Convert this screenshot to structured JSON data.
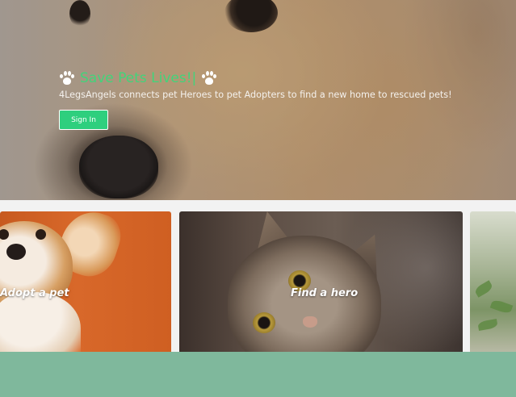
{
  "hero": {
    "title": "Save Pets Lives!|",
    "subtitle": "4LegsAngels connects pet Heroes to pet Adopters to find a new home to rescued pets!",
    "signin_label": "Sign In",
    "icons": [
      "paw-icon",
      "paw-icon"
    ]
  },
  "cards": [
    {
      "label": "Adopt a pet"
    },
    {
      "label": "Find a hero"
    },
    {
      "label": ""
    }
  ],
  "colors": {
    "accent": "#42d47a",
    "button": "#2ecf7e",
    "footer": "#7fb89c",
    "band": "#f2f2f2"
  }
}
